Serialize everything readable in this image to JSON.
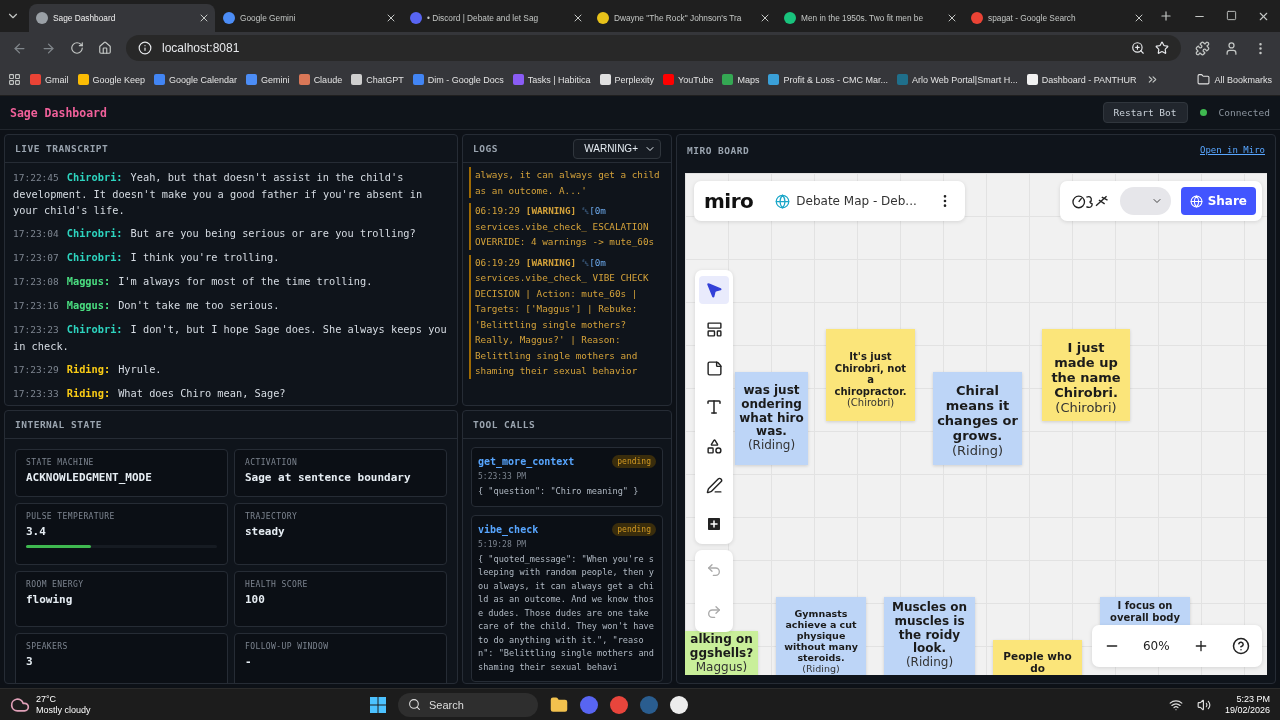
{
  "browser": {
    "tabs": [
      {
        "title": "Sage Dashboard",
        "selected": true,
        "color": "#9aa0a6"
      },
      {
        "title": "Google Gemini",
        "selected": false,
        "color": "#4c8df6"
      },
      {
        "title": "• Discord | Debate and let Sag",
        "selected": false,
        "color": "#5865f2"
      },
      {
        "title": "Dwayne \"The Rock\" Johnson's Tra",
        "selected": false,
        "color": "#e8c21a"
      },
      {
        "title": "Men in the 1950s. Two fit men be",
        "selected": false,
        "color": "#19c37d"
      },
      {
        "title": "spagat - Google Search",
        "selected": false,
        "color": "#ea4335"
      }
    ],
    "address": "localhost:8081",
    "bookmarks": [
      {
        "label": "Gmail",
        "color": "#ea4335"
      },
      {
        "label": "Google Keep",
        "color": "#fbbc04"
      },
      {
        "label": "Google Calendar",
        "color": "#4285f4"
      },
      {
        "label": "Gemini",
        "color": "#4c8df6"
      },
      {
        "label": "Claude",
        "color": "#d97757"
      },
      {
        "label": "ChatGPT",
        "color": "#cfcfcf"
      },
      {
        "label": "Dim - Google Docs",
        "color": "#4285f4"
      },
      {
        "label": "Tasks | Habitica",
        "color": "#8a5cf5"
      },
      {
        "label": "Perplexity",
        "color": "#e0e0e0"
      },
      {
        "label": "YouTube",
        "color": "#ff0000"
      },
      {
        "label": "Maps",
        "color": "#34a853"
      },
      {
        "label": "Profit & Loss - CMC Mar...",
        "color": "#3aa0d8"
      },
      {
        "label": "Arlo Web Portal|Smart H...",
        "color": "#1f6f8b"
      },
      {
        "label": "Dashboard - PANTHUR",
        "color": "#f1f1f1"
      }
    ],
    "all_bookmarks": "All Bookmarks"
  },
  "app": {
    "title": "Sage Dashboard",
    "restart_button": "Restart Bot",
    "status": {
      "label": "Connected",
      "connected": true
    }
  },
  "transcript": {
    "title": "LIVE TRANSCRIPT",
    "entries": [
      {
        "time": "17:22:45",
        "speaker": "Chirobri:",
        "color": "#2dd4bf",
        "text": "Yeah, but that doesn't assist in the child's development. It doesn't make you a good father if you're absent in your child's life."
      },
      {
        "time": "17:23:04",
        "speaker": "Chirobri:",
        "color": "#2dd4bf",
        "text": "But are you being serious or are you trolling?"
      },
      {
        "time": "17:23:07",
        "speaker": "Chirobri:",
        "color": "#2dd4bf",
        "text": "I think you're trolling."
      },
      {
        "time": "17:23:08",
        "speaker": "Maggus:",
        "color": "#4ade80",
        "text": "I'm always for most of the time trolling."
      },
      {
        "time": "17:23:16",
        "speaker": "Maggus:",
        "color": "#4ade80",
        "text": "Don't take me too serious."
      },
      {
        "time": "17:23:23",
        "speaker": "Chirobri:",
        "color": "#2dd4bf",
        "text": "I don't, but I hope Sage does. She always keeps you in check."
      },
      {
        "time": "17:23:29",
        "speaker": "Riding:",
        "color": "#facc15",
        "text": "Hyrule."
      },
      {
        "time": "17:23:33",
        "speaker": "Riding:",
        "color": "#facc15",
        "text": "What does Chiro mean, Sage?"
      }
    ]
  },
  "logs": {
    "title": "LOGS",
    "filter": "WARNING+",
    "entries": [
      {
        "kind": "tail",
        "text": "always, it can always get a child as an outcome. A...'"
      },
      {
        "kind": "entry",
        "time": "06:19:29",
        "level": "[WARNING]",
        "code": "␛[0m",
        "text": "services.vibe_check_ ESCALATION OVERRIDE: 4 warnings -> mute_60s"
      },
      {
        "kind": "entry",
        "time": "06:19:29",
        "level": "[WARNING]",
        "code": "␛[0m",
        "text": "services.vibe_check_ VIBE CHECK DECISION | Action: mute_60s | Targets: ['Maggus'] | Rebuke: 'Belittling single mothers? Really, Maggus?' | Reason: Belittling single mothers and shaming their sexual behavior"
      }
    ]
  },
  "internal_state": {
    "title": "INTERNAL STATE",
    "cards": [
      {
        "label": "STATE MACHINE",
        "value": "ACKNOWLEDGMENT_MODE"
      },
      {
        "label": "ACTIVATION",
        "value": "Sage at sentence boundary"
      },
      {
        "label": "PULSE TEMPERATURE",
        "value": "3.4",
        "level": 0.34
      },
      {
        "label": "TRAJECTORY",
        "value": "steady"
      },
      {
        "label": "ROOM ENERGY",
        "value": "flowing"
      },
      {
        "label": "HEALTH SCORE",
        "value": "100"
      },
      {
        "label": "SPEAKERS",
        "value": "3"
      },
      {
        "label": "FOLLOW-UP WINDOW",
        "value": "-"
      }
    ]
  },
  "tool_calls": {
    "title": "TOOL CALLS",
    "calls": [
      {
        "name": "get_more_context",
        "status": "pending",
        "time": "5:23:33 PM",
        "args": "{ \"question\": \"Chiro meaning\" }"
      },
      {
        "name": "vibe_check",
        "status": "pending",
        "time": "5:19:28 PM",
        "args": "{ \"quoted_message\": \"When you're sleeping with random people, then you always, it can always get a child as an outcome. And we know those dudes. Those dudes are one take care of the child. They won't have to do anything with it.\", \"reason\": \"Belittling single mothers and shaming their sexual behavi"
      }
    ]
  },
  "miro": {
    "title": "MIRO BOARD",
    "link": "Open in Miro",
    "board": {
      "logo": "miro",
      "name": "Debate Map - Deb...",
      "share": "Share",
      "zoom": "60%",
      "notes": [
        {
          "text": "It's just Chirobri, not a chiropractor.",
          "author": "(Chirobri)",
          "color": "#fbe57a"
        },
        {
          "text": "I just made up the name Chirobri.",
          "author": "(Chirobri)",
          "color": "#fbe57a"
        },
        {
          "text": "was just ondering what hiro was.",
          "author": "(Riding)",
          "color": "#bdd5f7"
        },
        {
          "text": "Chiral means it changes or grows.",
          "author": "(Riding)",
          "color": "#bdd5f7"
        },
        {
          "text": "alking on ggshells?",
          "author": "Maggus)",
          "color": "#c9ef9a"
        },
        {
          "text": "Gymnasts achieve a cut physique without many steroids.",
          "author": "(Riding)",
          "color": "#bdd5f7"
        },
        {
          "text": "Muscles on muscles is the roidy look.",
          "author": "(Riding)",
          "color": "#bdd5f7"
        },
        {
          "text": "People who do",
          "color": "#fbe57a"
        },
        {
          "text": "I focus on overall body",
          "color": "#bdd5f7"
        }
      ]
    }
  },
  "taskbar": {
    "temperature": "27°C",
    "condition": "Mostly cloudy",
    "search": "Search",
    "time": "5:23 PM",
    "date": "19/02/2026"
  }
}
